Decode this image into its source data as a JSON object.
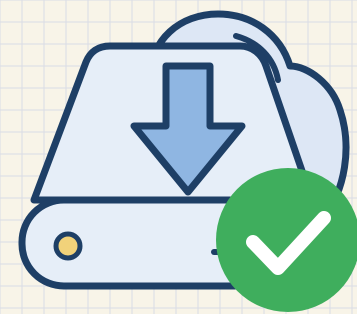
{
  "illustration": {
    "subject": "cloud-drive-download-complete",
    "icons": [
      "cloud-icon",
      "drive-icon",
      "download-arrow-icon",
      "checkmark-badge-icon",
      "led-indicator-icon"
    ],
    "colors": {
      "background": "#f8f4e8",
      "grid_line": "#d9dce6",
      "outline": "#1e3f66",
      "cloud_fill": "#dde7f5",
      "drive_fill": "#e6eef8",
      "arrow_fill": "#8fb6e2",
      "led_fill": "#f1d27a",
      "badge_fill": "#3fae5d",
      "check_stroke": "#ffffff"
    }
  }
}
